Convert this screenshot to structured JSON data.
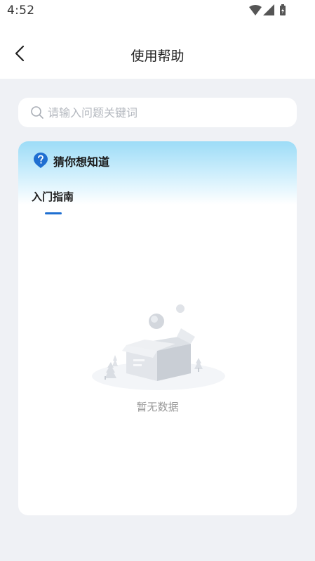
{
  "status_bar": {
    "time": "4:52"
  },
  "nav": {
    "title": "使用帮助"
  },
  "search": {
    "placeholder": "请输入问题关键词",
    "value": ""
  },
  "card": {
    "title": "猜你想知道",
    "tabs": [
      {
        "label": "入门指南",
        "active": true
      }
    ],
    "empty_text": "暂无数据"
  },
  "colors": {
    "accent": "#1f6fd1",
    "page_bg": "#eff1f5",
    "header_gradient_top": "#9ddcf7"
  },
  "icons": {
    "back": "chevron-left-icon",
    "search": "search-icon",
    "help": "question-pin-icon",
    "empty": "empty-box-illustration"
  }
}
